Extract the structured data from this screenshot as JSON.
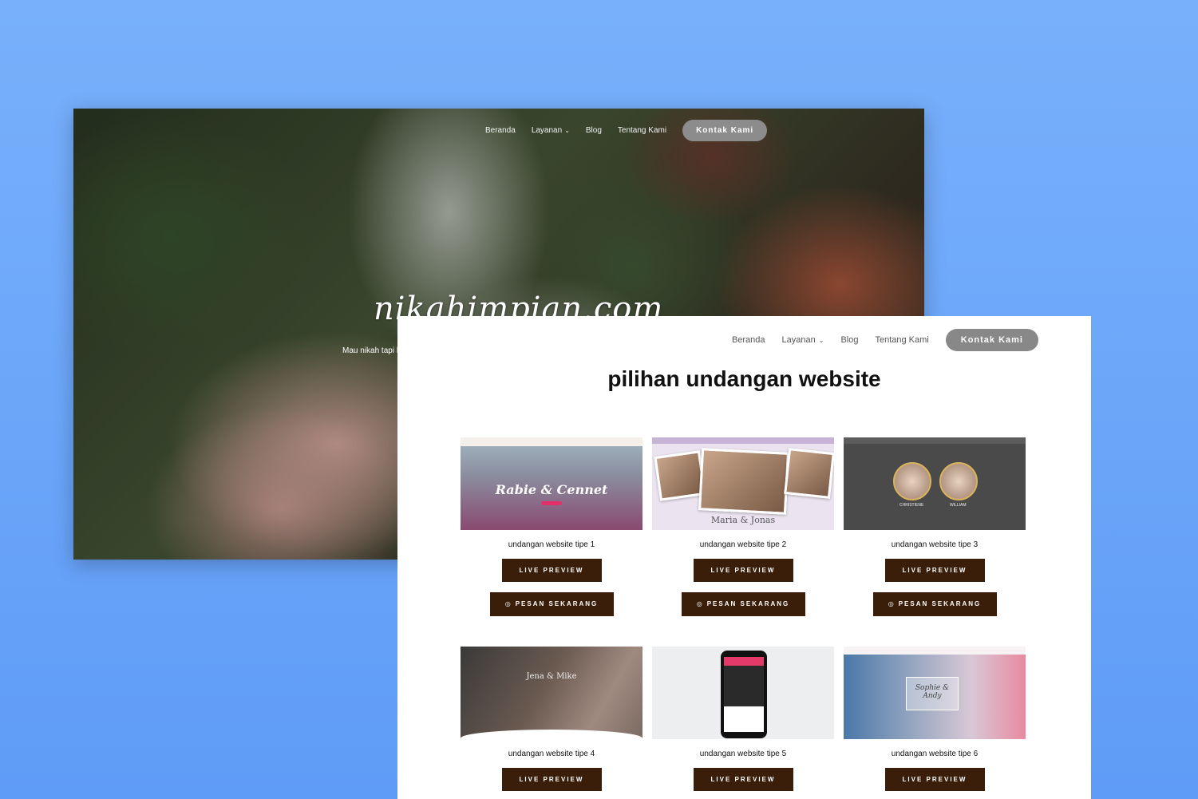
{
  "hero": {
    "nav": [
      "Beranda",
      "Layanan",
      "Blog",
      "Tentang Kami"
    ],
    "contact_label": "Kontak Kami",
    "title": "nikahimpian.com",
    "subtitle": "Mau nikah tapi b"
  },
  "front": {
    "nav": [
      "Beranda",
      "Layanan",
      "Blog",
      "Tentang Kami"
    ],
    "contact_label": "Kontak Kami",
    "title": "pilihan undangan website",
    "live_label": "LIVE PREVIEW",
    "order_label": "PESAN SEKARANG",
    "cards": [
      {
        "caption": "undangan website tipe 1",
        "thumb_text": "Rabie & Cennet"
      },
      {
        "caption": "undangan website tipe 2",
        "thumb_text": "Maria & Jonas"
      },
      {
        "caption": "undangan website tipe 3",
        "thumb_text_left": "CHRISTIENE",
        "thumb_text_right": "WILLIAM"
      },
      {
        "caption": "undangan website tipe 4",
        "thumb_text": "Jena & Mike"
      },
      {
        "caption": "undangan website tipe 5",
        "thumb_text": ""
      },
      {
        "caption": "undangan website tipe 6",
        "thumb_text": "Sophie & Andy"
      }
    ]
  },
  "colors": {
    "background": "#6ba6f9",
    "button_dark": "#3a1e0a",
    "contact_button": "#888888"
  },
  "icons": [
    "caret-down-icon",
    "whatsapp-icon"
  ]
}
